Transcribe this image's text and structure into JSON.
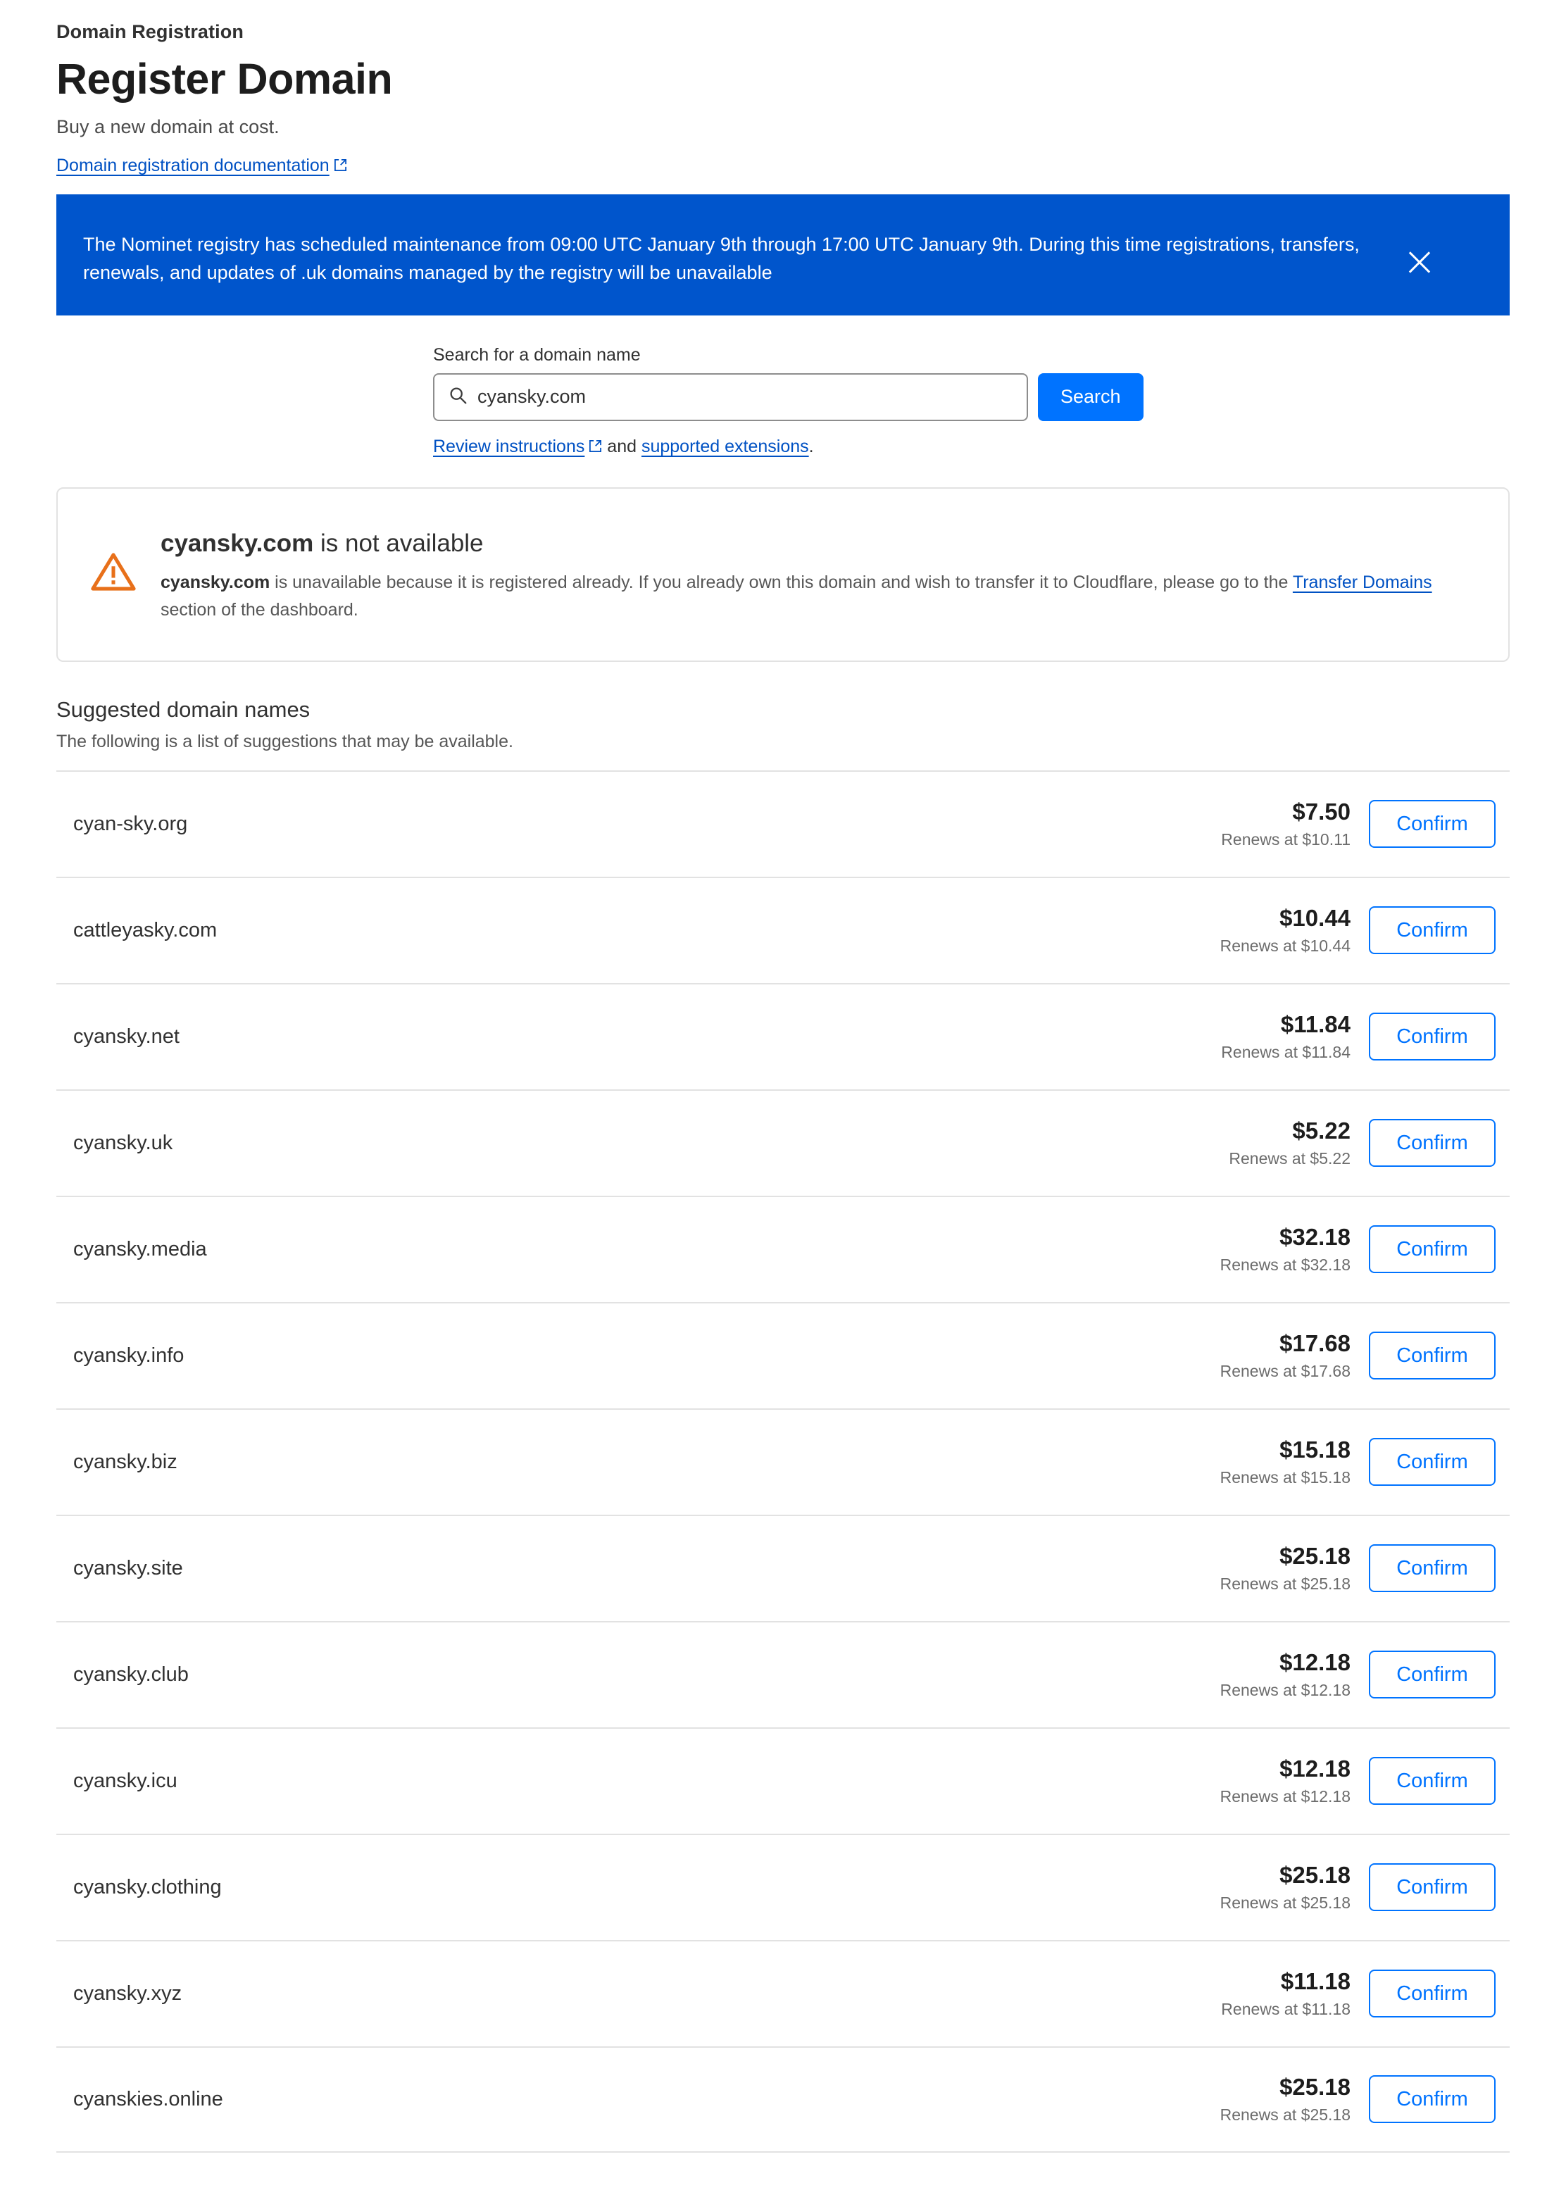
{
  "header": {
    "eyebrow": "Domain Registration",
    "title": "Register Domain",
    "subtitle": "Buy a new domain at cost.",
    "doc_link": "Domain registration documentation",
    "doc_link_icon": "external-link-icon"
  },
  "banner": {
    "message": "The Nominet registry has scheduled maintenance from 09:00 UTC January 9th through 17:00 UTC January 9th. During this time registrations, transfers, renewals, and updates of .uk domains managed by the registry will be unavailable",
    "close_icon": "close-icon",
    "background_color": "#0055cc",
    "text_color": "#ffffff"
  },
  "search": {
    "label": "Search for a domain name",
    "value": "cyansky.com",
    "placeholder": "Search for a domain name",
    "icon": "search-icon",
    "button_label": "Search",
    "button_color": "#0073ff",
    "links_prefix": "",
    "link_instructions": "Review instructions",
    "link_instructions_icon": "external-link-icon",
    "links_conjunction": " and ",
    "link_extensions": "supported extensions",
    "links_suffix": "."
  },
  "alert": {
    "icon": "warning-triangle-icon",
    "icon_color": "#e8701a",
    "title_strong": "cyansky.com",
    "title_rest": " is not available",
    "desc_strong": "cyansky.com",
    "desc_part1": " is unavailable because it is registered already. If you already own this domain and wish to transfer it to Cloudflare, please go to the ",
    "desc_link": "Transfer Domains",
    "desc_part2": " section of the dashboard."
  },
  "suggestions": {
    "title": "Suggested domain names",
    "subtitle": "The following is a list of suggestions that may be available.",
    "confirm_label": "Confirm",
    "rows": [
      {
        "name": "cyan-sky.org",
        "price": "$7.50",
        "renews": "Renews at $10.11"
      },
      {
        "name": "cattleyasky.com",
        "price": "$10.44",
        "renews": "Renews at $10.44"
      },
      {
        "name": "cyansky.net",
        "price": "$11.84",
        "renews": "Renews at $11.84"
      },
      {
        "name": "cyansky.uk",
        "price": "$5.22",
        "renews": "Renews at $5.22"
      },
      {
        "name": "cyansky.media",
        "price": "$32.18",
        "renews": "Renews at $32.18"
      },
      {
        "name": "cyansky.info",
        "price": "$17.68",
        "renews": "Renews at $17.68"
      },
      {
        "name": "cyansky.biz",
        "price": "$15.18",
        "renews": "Renews at $15.18"
      },
      {
        "name": "cyansky.site",
        "price": "$25.18",
        "renews": "Renews at $25.18"
      },
      {
        "name": "cyansky.club",
        "price": "$12.18",
        "renews": "Renews at $12.18"
      },
      {
        "name": "cyansky.icu",
        "price": "$12.18",
        "renews": "Renews at $12.18"
      },
      {
        "name": "cyansky.clothing",
        "price": "$25.18",
        "renews": "Renews at $25.18"
      },
      {
        "name": "cyansky.xyz",
        "price": "$11.18",
        "renews": "Renews at $11.18"
      },
      {
        "name": "cyanskies.online",
        "price": "$25.18",
        "renews": "Renews at $25.18"
      }
    ]
  }
}
